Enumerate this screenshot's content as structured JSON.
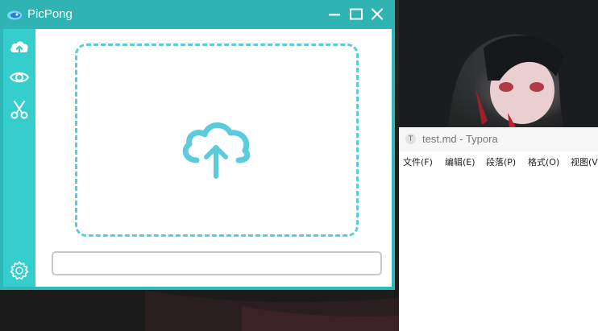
{
  "picpong": {
    "title": "PicPong",
    "url_input": {
      "value": "",
      "placeholder": ""
    }
  },
  "typora": {
    "window_title": "test.md - Typora",
    "icon_letter": "T",
    "menu": [
      "文件(F)",
      "编辑(E)",
      "段落(P)",
      "格式(O)",
      "视图(V)"
    ]
  },
  "colors": {
    "titlebar": "#2fb3b3",
    "sidebar": "#36cdcd",
    "accent": "#5cccdd",
    "typora_titlebar": "#f6f6f6"
  },
  "icons": {
    "sidebar": [
      "cloud-upload-icon",
      "eye-icon",
      "scissors-icon",
      "gear-icon"
    ],
    "drop_zone": "cloud-upload-icon"
  }
}
